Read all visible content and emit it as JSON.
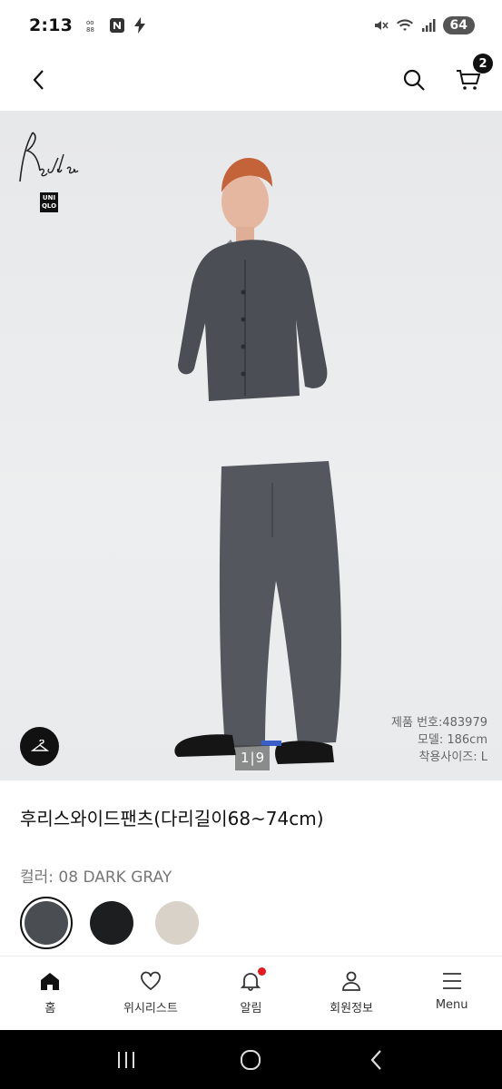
{
  "status_bar": {
    "time": "2:13",
    "battery": "64"
  },
  "header": {
    "cart_count": "2"
  },
  "gallery": {
    "pager_current": "1",
    "pager_total": "9",
    "info": {
      "product_number": "제품 번호:483979",
      "model_height": "모델: 186cm",
      "worn_size": "착용사이즈: L"
    }
  },
  "product": {
    "title": "후리스와이드팬츠(다리길이68~74cm)",
    "color_label": "컬러: 08 DARK GRAY",
    "colors": [
      {
        "hex": "#4a4e52",
        "selected": true
      },
      {
        "hex": "#1d1e20",
        "selected": false
      },
      {
        "hex": "#d8d2c8",
        "selected": false
      }
    ]
  },
  "bottom_nav": {
    "items": [
      {
        "label": "홈",
        "icon": "home-icon"
      },
      {
        "label": "위시리스트",
        "icon": "heart-icon"
      },
      {
        "label": "알림",
        "icon": "bell-icon"
      },
      {
        "label": "회원정보",
        "icon": "user-icon"
      },
      {
        "label": "Menu",
        "icon": "menu-icon"
      }
    ]
  }
}
